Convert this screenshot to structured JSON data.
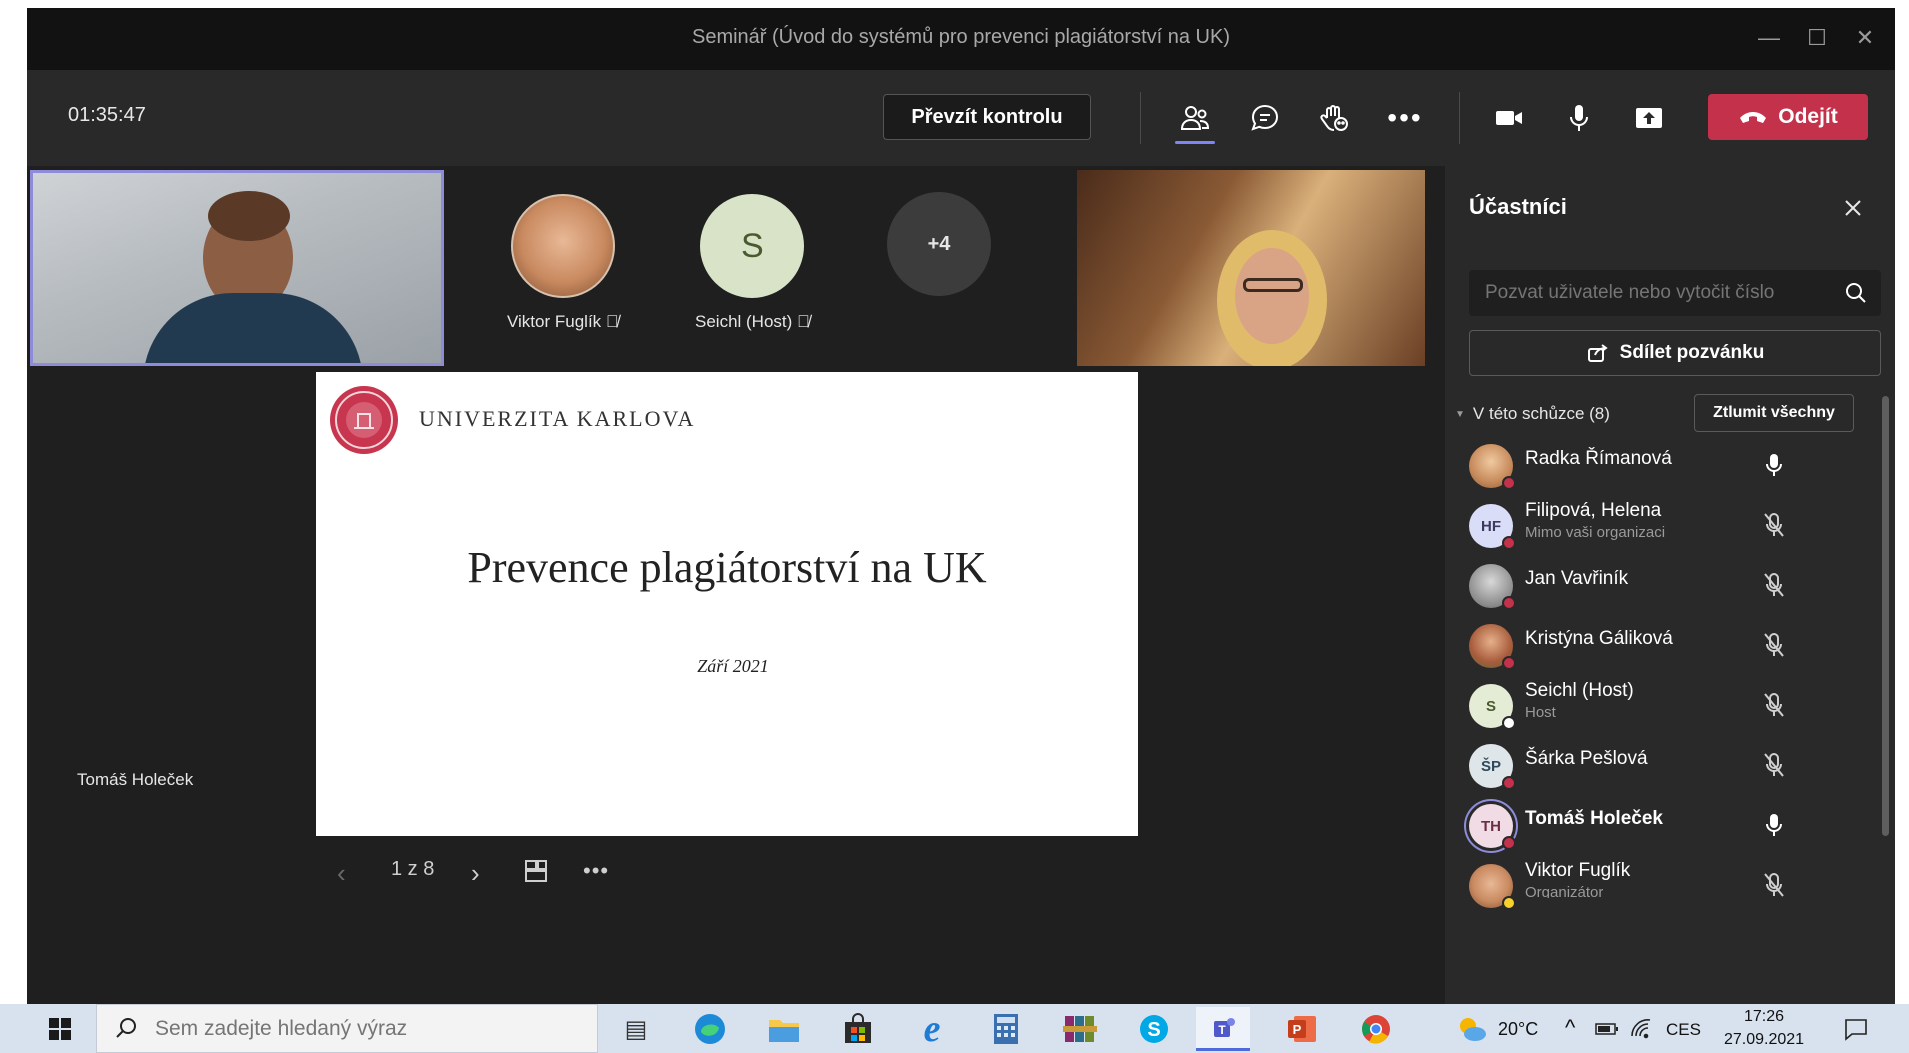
{
  "window": {
    "title": "Seminář (Úvod do systémů pro prevenci plagiátorství na UK)"
  },
  "toolbar": {
    "timer": "01:35:47",
    "take_control": "Převzít kontrolu",
    "leave": "Odejít"
  },
  "stage": {
    "tiles": [
      {
        "name": "Viktor Fuglík"
      },
      {
        "initial": "S",
        "name": "Seichl (Host)"
      },
      {
        "label": "+4"
      }
    ],
    "slide": {
      "university": "UNIVERZITA KARLOVA",
      "title": "Prevence plagiátorství na UK",
      "date": "Září 2021"
    },
    "slide_nav": {
      "page": "1 z 8"
    },
    "presenter": "Tomáš Holeček"
  },
  "panel": {
    "title": "Účastníci",
    "invite_placeholder": "Pozvat uživatele nebo vytočit číslo",
    "share_invite": "Sdílet pozvánku",
    "section": "V této schůzce (8)",
    "mute_all": "Ztlumit všechny",
    "participants": [
      {
        "name": "Radka Římanová",
        "sub": "",
        "initials": "",
        "muted": false
      },
      {
        "name": "Filipová, Helena",
        "sub": "Mimo vaši organizaci",
        "initials": "HF",
        "muted": true
      },
      {
        "name": "Jan Vavřiník",
        "sub": "",
        "initials": "",
        "muted": true
      },
      {
        "name": "Kristýna Gáliková",
        "sub": "",
        "initials": "",
        "muted": true
      },
      {
        "name": "Seichl (Host)",
        "sub": "Host",
        "initials": "S",
        "muted": true
      },
      {
        "name": "Šárka Pešlová",
        "sub": "",
        "initials": "ŠP",
        "muted": true
      },
      {
        "name": "Tomáš Holeček",
        "sub": "",
        "initials": "TH",
        "muted": false
      },
      {
        "name": "Viktor Fuglík",
        "sub": "Organizátor",
        "initials": "",
        "muted": true
      }
    ]
  },
  "taskbar": {
    "search_placeholder": "Sem zadejte hledaný výraz",
    "weather": "20°C",
    "language": "CES",
    "time": "17:26",
    "date": "27.09.2021"
  }
}
